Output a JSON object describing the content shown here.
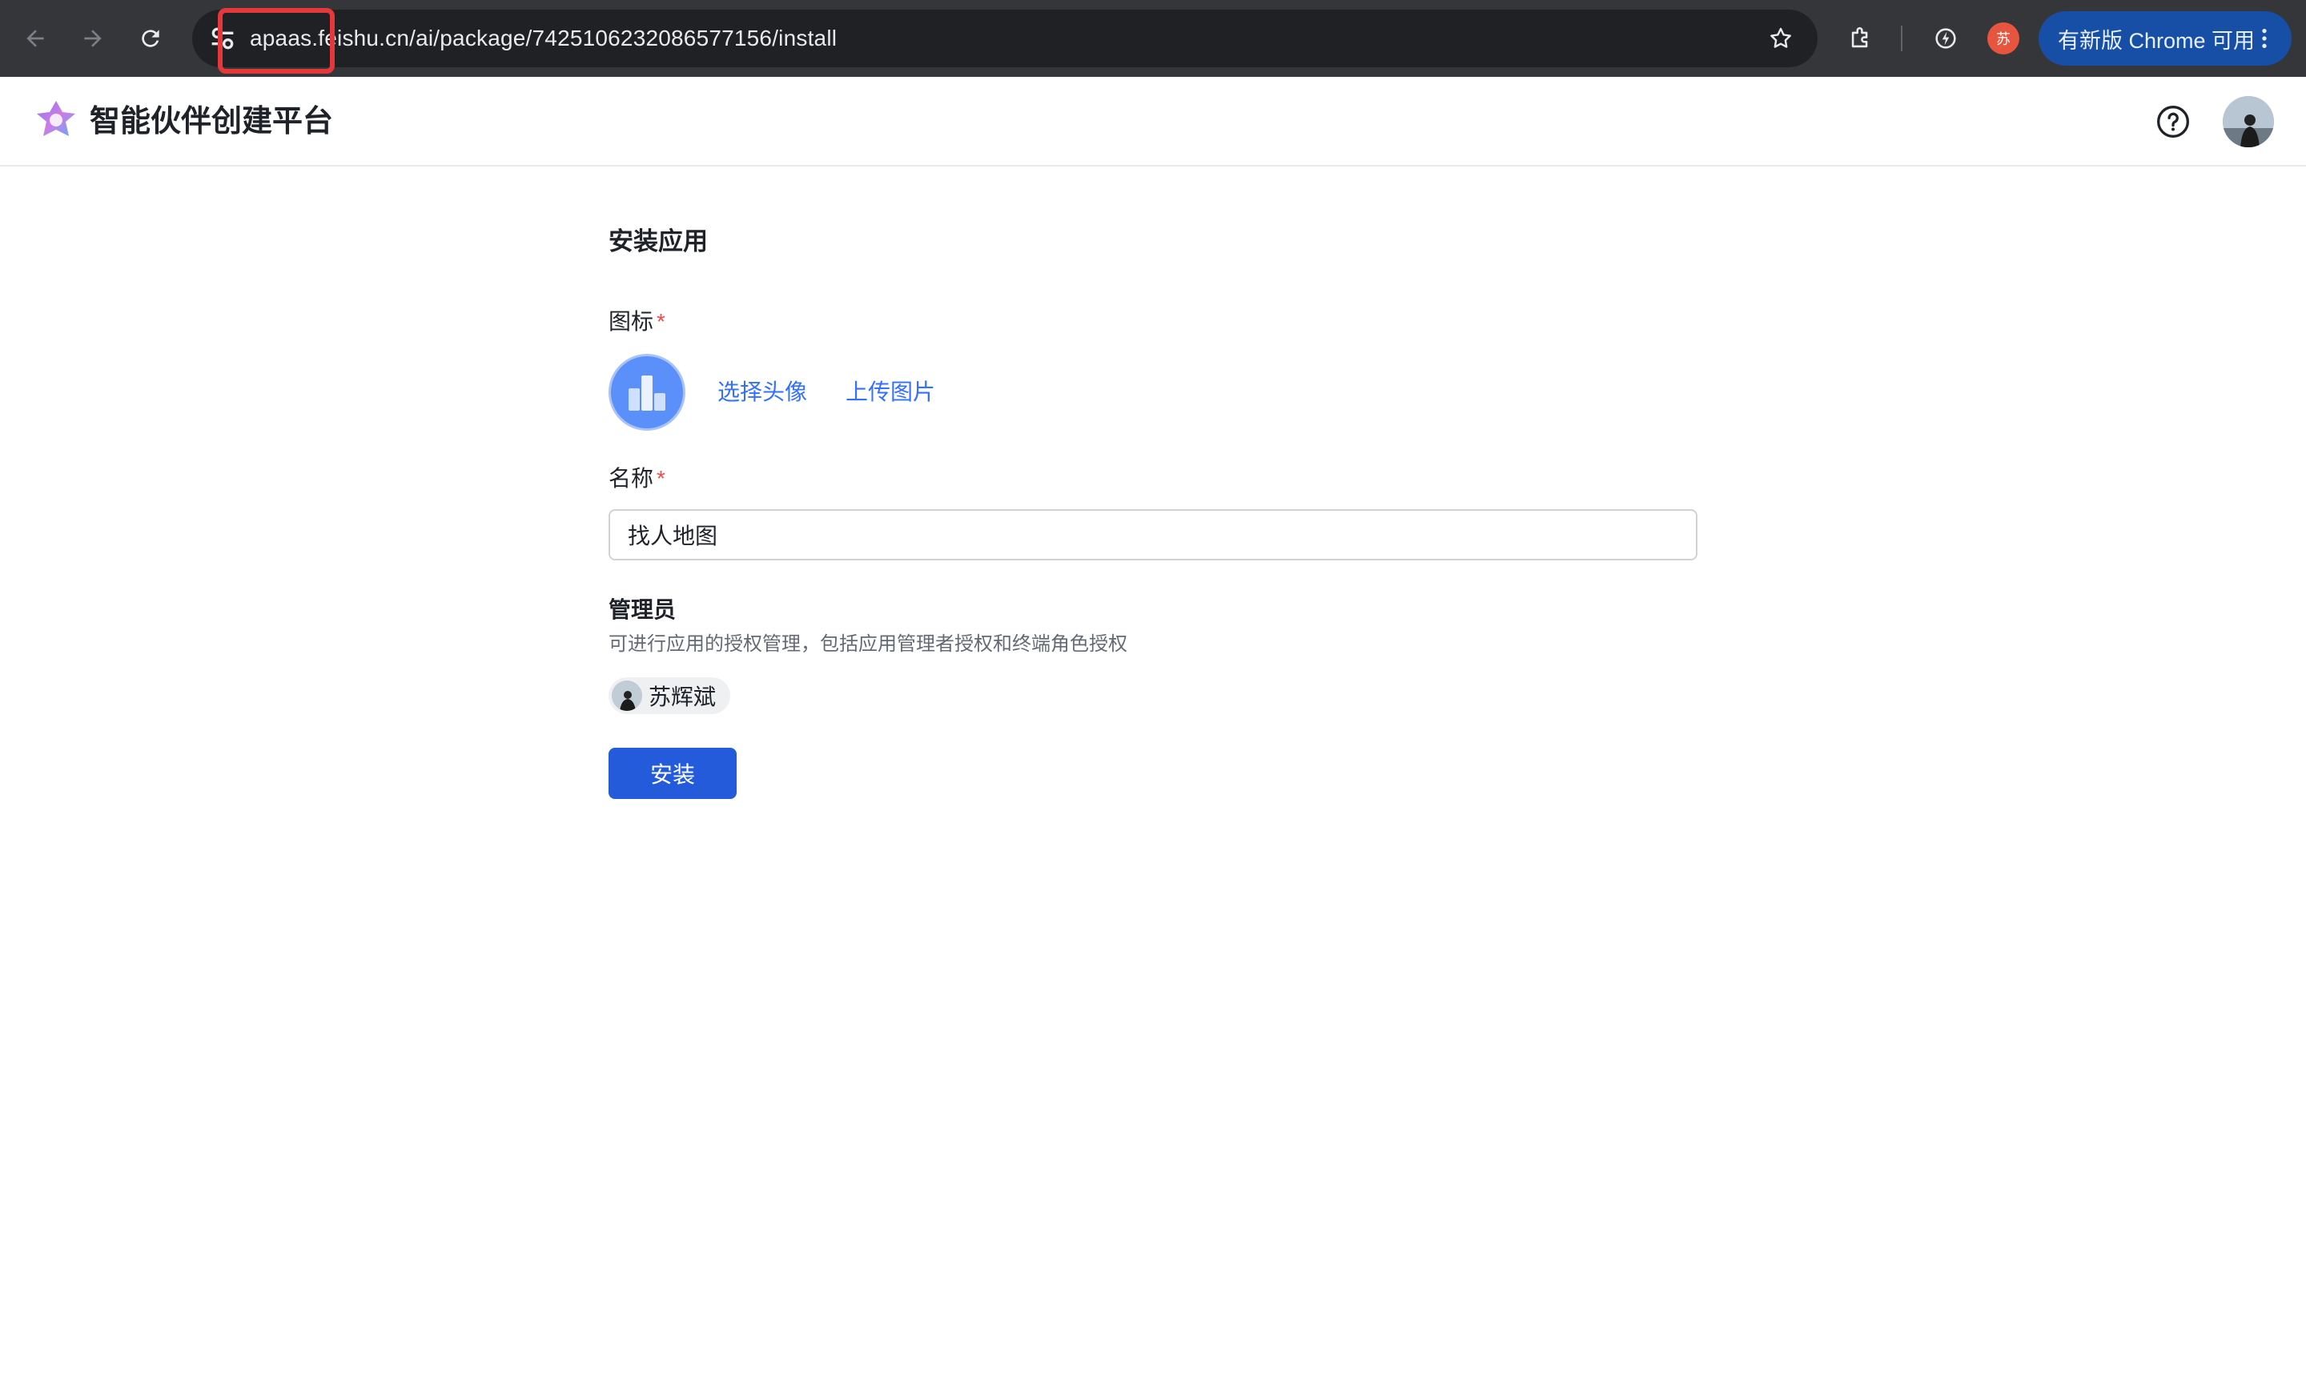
{
  "browser": {
    "url": "apaas.feishu.cn/ai/package/7425106232086577156/install",
    "profile_initial": "苏",
    "update_label": "有新版 Chrome 可用",
    "icons": [
      "back-icon",
      "forward-icon",
      "reload-icon",
      "site-info-icon",
      "bookmark-star-icon",
      "extensions-icon",
      "performance-icon",
      "more-vert-icon"
    ],
    "highlight_color": "#e5383b"
  },
  "app": {
    "title": "智能伙伴创建平台",
    "icons": [
      "app-logo-icon",
      "help-icon"
    ]
  },
  "form": {
    "title": "安装应用",
    "icon_label": "图标",
    "required_mark": "*",
    "choose_avatar_label": "选择头像",
    "upload_image_label": "上传图片",
    "name_label": "名称",
    "name_value": "找人地图",
    "admin_label": "管理员",
    "admin_description": "可进行应用的授权管理，包括应用管理者授权和终端角色授权",
    "admins": [
      {
        "name": "苏辉斌"
      }
    ],
    "install_button": "安装"
  },
  "colors": {
    "primary": "#245bdb",
    "link": "#3370ff",
    "required": "#f54a45",
    "chrome_update": "#174ea6"
  }
}
